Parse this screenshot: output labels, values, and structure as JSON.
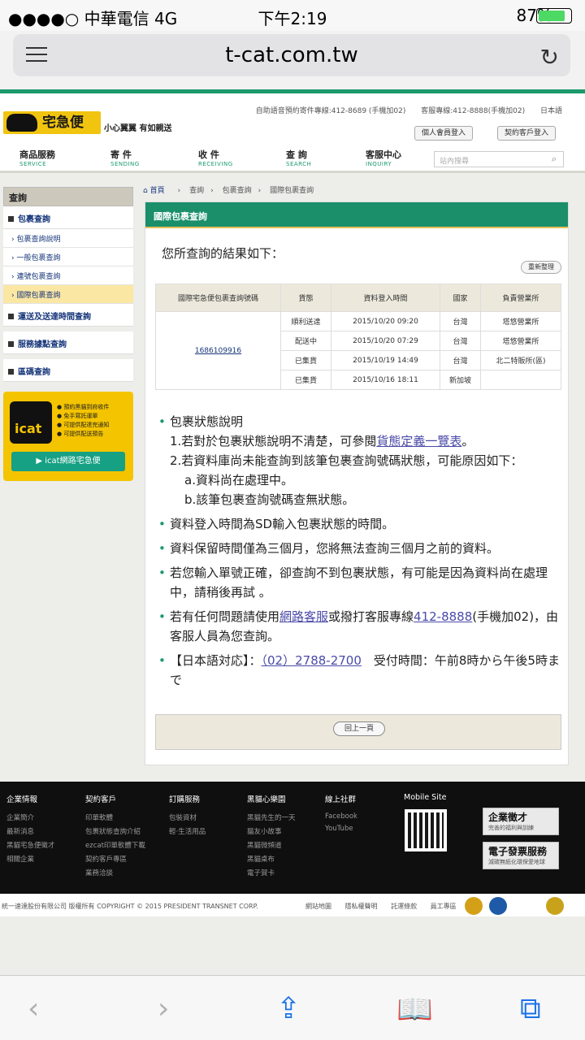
{
  "status": {
    "carrier": "●●●●○ 中華電信  4G",
    "time": "下午2:19",
    "battery": "87%",
    "battery_level": 0.87
  },
  "browser": {
    "url": "t-cat.com.tw"
  },
  "site": {
    "logo": "宅急便",
    "slogan": "小心翼翼 有如親送",
    "top_links": [
      "自助語音預約寄件專線:412-8689 (手機加02)",
      "客服專線:412-8888(手機加02)",
      "日本語"
    ],
    "member_btn": "個人會員登入",
    "contract_btn": "契約客戶登入",
    "nav": [
      {
        "zh": "商品服務",
        "en": "SERVICE"
      },
      {
        "zh": "寄 件",
        "en": "SENDING"
      },
      {
        "zh": "收 件",
        "en": "RECEIVING"
      },
      {
        "zh": "查 詢",
        "en": "SEARCH"
      },
      {
        "zh": "客服中心",
        "en": "INQUIRY"
      }
    ],
    "search_placeholder": "站內搜尋"
  },
  "sidebar": {
    "title": "查詢",
    "sections": [
      "包裹查詢",
      "運送及送達時間查詢",
      "服務據點查詢",
      "區碼查詢"
    ],
    "subs": [
      "包裹查詢說明",
      "一般包裹查詢",
      "連號包裹查詢",
      "國際包裹查詢"
    ],
    "icat_list": [
      "預約黑貓到府收件",
      "免手寫託運單",
      "可提供配達完通知",
      "可提供配送預告"
    ],
    "icat_logo": "icat",
    "icat_btn": "icat網路宅急便"
  },
  "breadcrumb": [
    "首頁",
    "查詢",
    "包裹查詢",
    "國際包裹查詢"
  ],
  "panel": {
    "title": "國際包裹查詢",
    "result": "您所查詢的結果如下：",
    "reset": "重新整理",
    "headers": [
      "國際宅急便包裹查詢號碼",
      "貨態",
      "資料登入時間",
      "國家",
      "負責營業所"
    ],
    "tracking_no": "1686109916",
    "rows": [
      [
        "順利送達",
        "2015/10/20 09:20",
        "台灣",
        "塔悠營業所"
      ],
      [
        "配送中",
        "2015/10/20 07:29",
        "台灣",
        "塔悠營業所"
      ],
      [
        "已集貨",
        "2015/10/19 14:49",
        "台灣",
        "北二特販所(區)"
      ],
      [
        "已集貨",
        "2015/10/16 18:11",
        "新加坡",
        ""
      ]
    ],
    "n1_title": "包裹狀態說明",
    "n1_a": "1.若對於包裹狀態說明不清楚，可參閱",
    "n1_link": "貨態定義一覽表",
    "n1_end": "。",
    "n1_b": "2.若資料庫尚未能查詢到該筆包裹查詢號碼狀態，可能原因如下：",
    "n1_c": "a.資料尚在處理中。",
    "n1_d": "b.該筆包裹查詢號碼查無狀態。",
    "n2": "資料登入時間為SD輸入包裹狀態的時間。",
    "n3": "資料保留時間僅為三個月，您將無法查詢三個月之前的資料。",
    "n4": "若您輸入單號正確，卻查詢不到包裹狀態，有可能是因為資料尚在處理中，請稍後再試 。",
    "n5_a": "若有任何問題請使用",
    "n5_link1": "網路客服",
    "n5_b": "或撥打客服專線",
    "n5_link2": "412-8888",
    "n5_c": "(手機加02)，由客服人員為您查詢。",
    "n6_a": "【日本語対応】：",
    "n6_link": "（02）2788-2700",
    "n6_b": "　受付時間：午前8時から午後5時まで",
    "back": "回上一頁"
  },
  "footer": {
    "cols": [
      {
        "t": "企業情報",
        "i": [
          "企業簡介",
          "最新消息",
          "黑貓宅急便徵才",
          "相關企業"
        ]
      },
      {
        "t": "契約客戶",
        "i": [
          "印單軟體",
          "包裹狀態查詢介紹",
          "ezcat印單軟體下載",
          "契約客戶專區",
          "業務洽談"
        ]
      },
      {
        "t": "訂購服務",
        "i": [
          "包裝資材",
          "輕‧生活用品"
        ]
      },
      {
        "t": "黑貓心樂園",
        "i": [
          "黑貓先生的一天",
          "貓友小故事",
          "黑貓微頻道",
          "黑貓桌布",
          "電子賀卡"
        ]
      },
      {
        "t": "線上社群",
        "i": [
          "Facebook",
          "YouTube"
        ]
      },
      {
        "t": "Mobile Site",
        "i": []
      }
    ],
    "badge1": "企業徵才",
    "badge1_sub": "完善的福利與訓練",
    "badge2": "電子發票服務",
    "badge2_sub": "減碳無紙化環保愛地球",
    "copyright": "統一速達股份有限公司 版權所有 COPYRIGHT © 2015 PRESIDENT TRANSNET CORP.",
    "links": [
      "網站地圖",
      "隱私權聲明",
      "託運條款",
      "員工專區"
    ]
  }
}
